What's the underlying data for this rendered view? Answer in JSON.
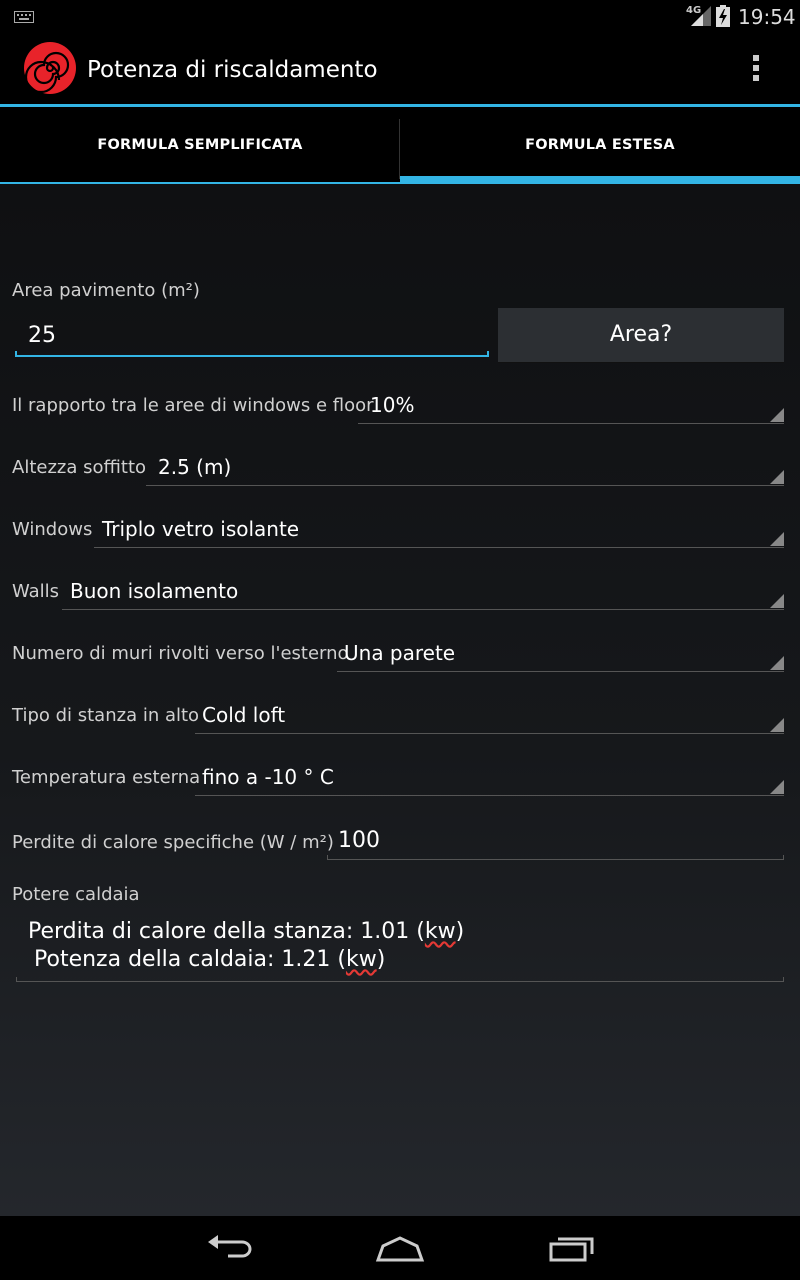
{
  "status_bar": {
    "network": "4G",
    "time": "19:54"
  },
  "action_bar": {
    "title": "Potenza di riscaldamento"
  },
  "tabs": [
    {
      "label": "FORMULA SEMPLIFICATA",
      "selected": false
    },
    {
      "label": "FORMULA ESTESA",
      "selected": true
    }
  ],
  "form": {
    "area": {
      "label": "Area pavimento (m²)",
      "value": "25",
      "button": "Area?"
    },
    "window_ratio": {
      "label": "Il rapporto tra le aree di windows e floor",
      "value": "10%"
    },
    "ceiling_height": {
      "label": "Altezza soffitto",
      "value": "2.5 (m)"
    },
    "windows": {
      "label": "Windows",
      "value": "Triplo vetro isolante"
    },
    "walls": {
      "label": "Walls",
      "value": "Buon isolamento"
    },
    "external_walls": {
      "label": "Numero di muri rivolti verso l'esterno",
      "value": "Una parete"
    },
    "room_above": {
      "label": "Tipo di stanza in alto",
      "value": "Cold loft"
    },
    "outside_temp": {
      "label": "Temperatura esterna",
      "value": "fino a -10 ° C"
    },
    "specific_loss": {
      "label": "Perdite di calore specifiche (W / m²)",
      "value": "100"
    }
  },
  "result": {
    "label": "Potere caldaia",
    "line1_prefix": "Perdita di calore della stanza: 1.01 (",
    "line1_unit": "kw",
    "line1_suffix": ")",
    "line2_prefix": "Potenza della caldaia: 1.21 (",
    "line2_unit": "kw",
    "line2_suffix": ")"
  },
  "colors": {
    "accent": "#33b5e5",
    "logo": "#e8232a",
    "spellcheck": "#e53935"
  },
  "icons": {
    "logo": "spiral-heater-icon",
    "menu": "overflow-menu-icon",
    "nav": [
      "back-icon",
      "home-icon",
      "recents-icon"
    ]
  }
}
